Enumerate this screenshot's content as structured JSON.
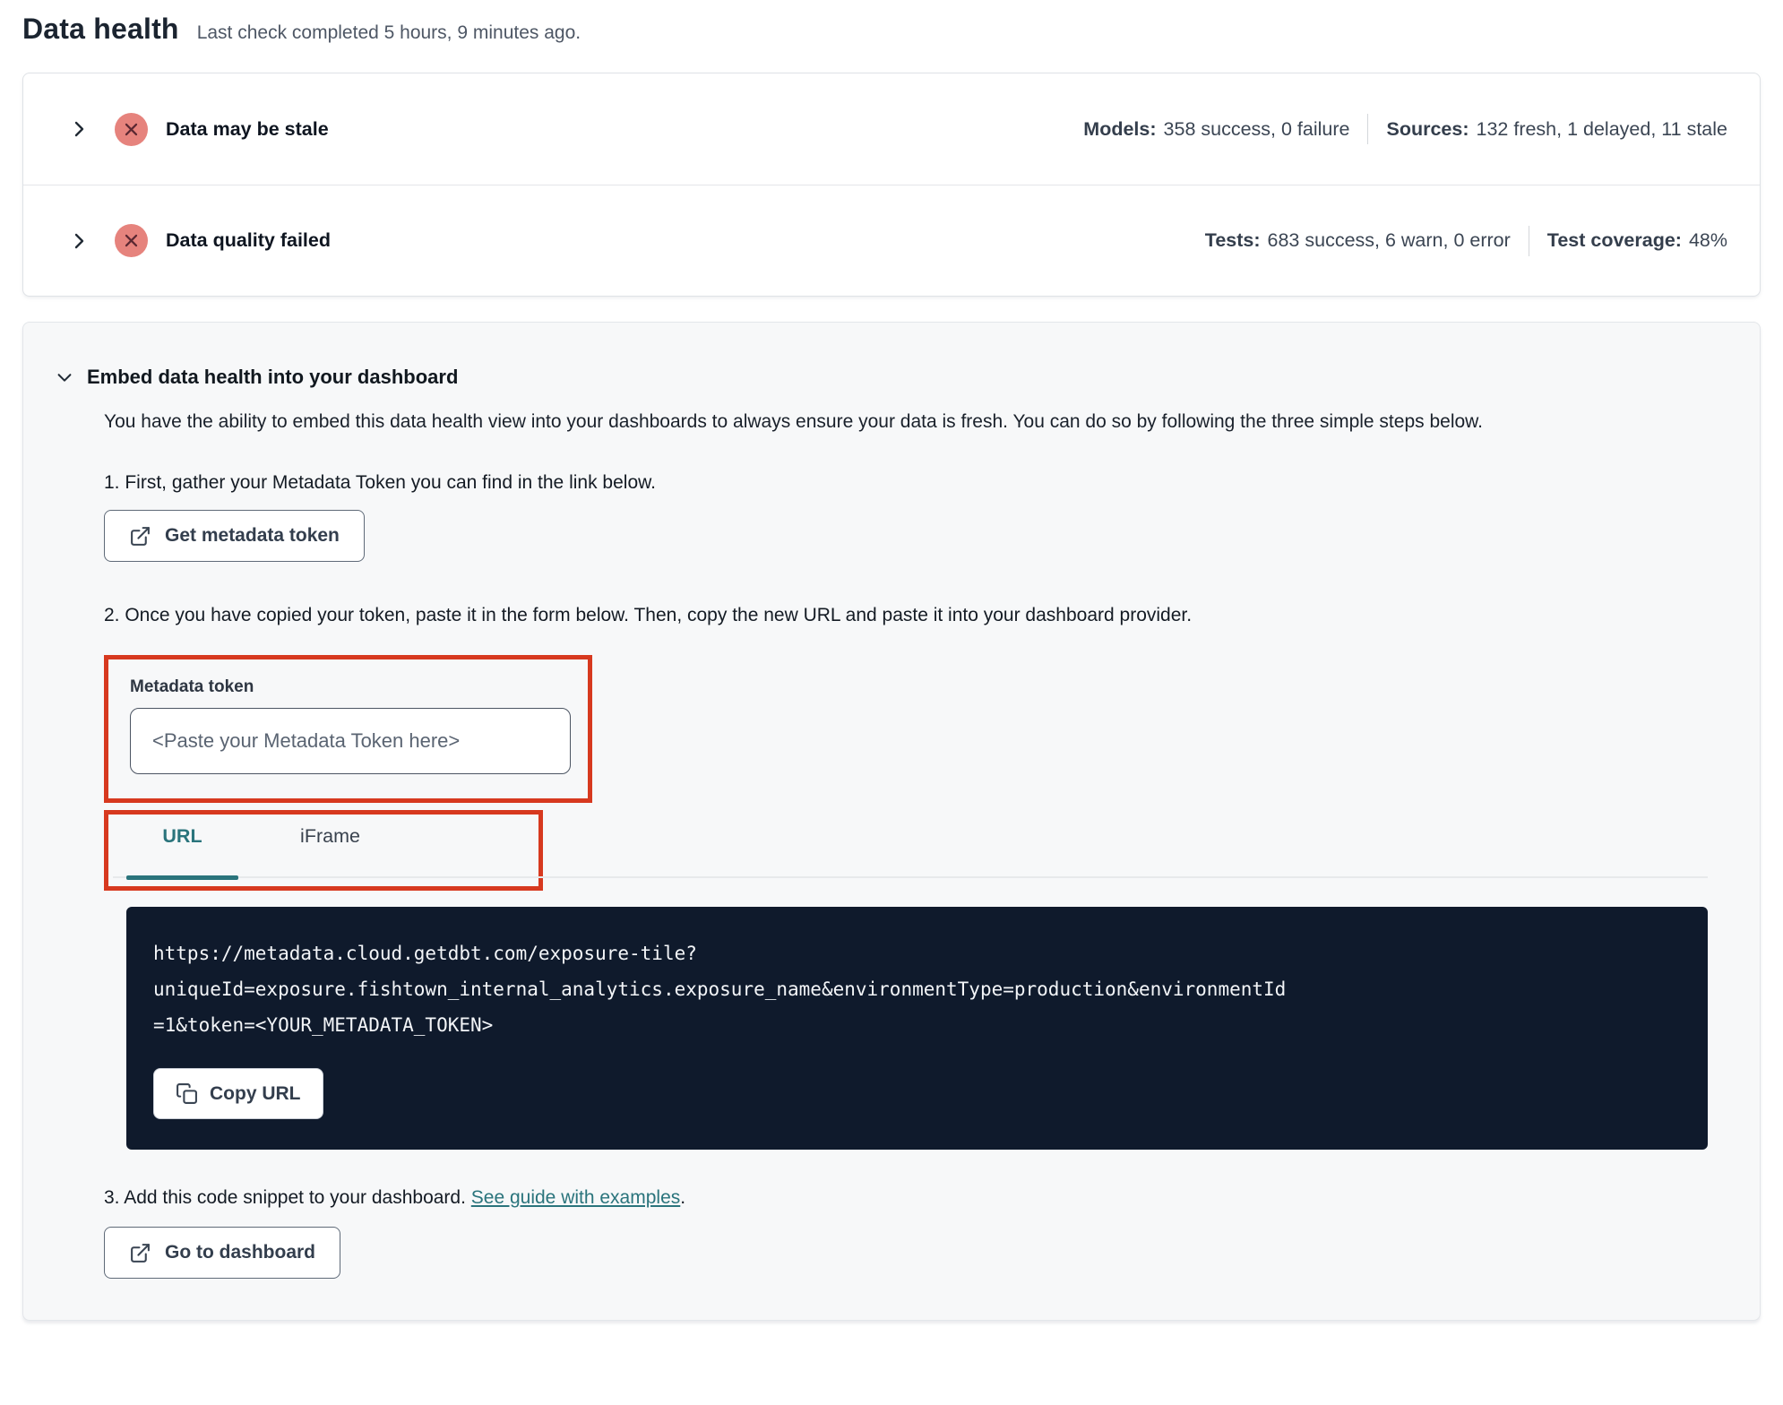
{
  "colors": {
    "teal": "#2a747c",
    "annotation_red": "#d7391f",
    "badge_bg": "#e6837d",
    "badge_x": "#5b2832",
    "code_bg": "#0f1a2c"
  },
  "header": {
    "title": "Data health",
    "subtitle": "Last check completed 5 hours, 9 minutes ago."
  },
  "status_rows": [
    {
      "title": "Data may be stale",
      "stats": [
        {
          "label": "Models:",
          "value": "358 success, 0 failure"
        },
        {
          "label": "Sources:",
          "value": "132 fresh, 1 delayed, 11 stale"
        }
      ]
    },
    {
      "title": "Data quality failed",
      "stats": [
        {
          "label": "Tests:",
          "value": "683 success, 6 warn, 0 error"
        },
        {
          "label": "Test coverage:",
          "value": "48%"
        }
      ]
    }
  ],
  "embed": {
    "title": "Embed data health into your dashboard",
    "description": "You have the ability to embed this data health view into your dashboards to always ensure your data is fresh. You can do so by following the three simple steps below.",
    "step1": "1. First, gather your Metadata Token you can find in the link below.",
    "get_token_button": "Get metadata token",
    "step2": "2. Once you have copied your token, paste it in the form below. Then, copy the new URL and paste it into your dashboard provider.",
    "token_field": {
      "label": "Metadata token",
      "placeholder": "<Paste your Metadata Token here>"
    },
    "tabs": [
      {
        "label": "URL"
      },
      {
        "label": "iFrame"
      }
    ],
    "code_url_lines": [
      "https://metadata.cloud.getdbt.com/exposure-tile?",
      "uniqueId=exposure.fishtown_internal_analytics.exposure_name&environmentType=production&environmentId",
      "=1&token=<YOUR_METADATA_TOKEN>"
    ],
    "copy_button": "Copy URL",
    "step3_prefix": "3. Add this code snippet to your dashboard. ",
    "step3_link": "See guide with examples",
    "step3_suffix": ".",
    "dashboard_button": "Go to dashboard"
  }
}
